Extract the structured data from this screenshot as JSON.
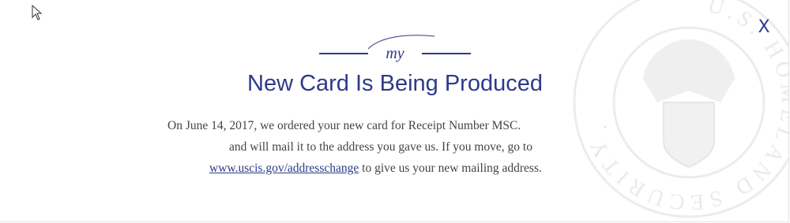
{
  "logo": {
    "text": "my"
  },
  "title": "New Card Is Being Produced",
  "close": {
    "label": "X"
  },
  "message": {
    "line1": "On June 14, 2017, we ordered your new card for Receipt Number MSC.",
    "line2": "and will mail it to the address you gave us. If you move, go to",
    "link_text": "www.uscis.gov/addresschange",
    "line3_suffix": " to give us your new mailing address."
  },
  "seal": {
    "text": "U.S. HOMELAND SECURITY"
  },
  "colors": {
    "brand": "#2d3a8a",
    "body_text": "#444444",
    "seal": "#e9e9e9"
  }
}
